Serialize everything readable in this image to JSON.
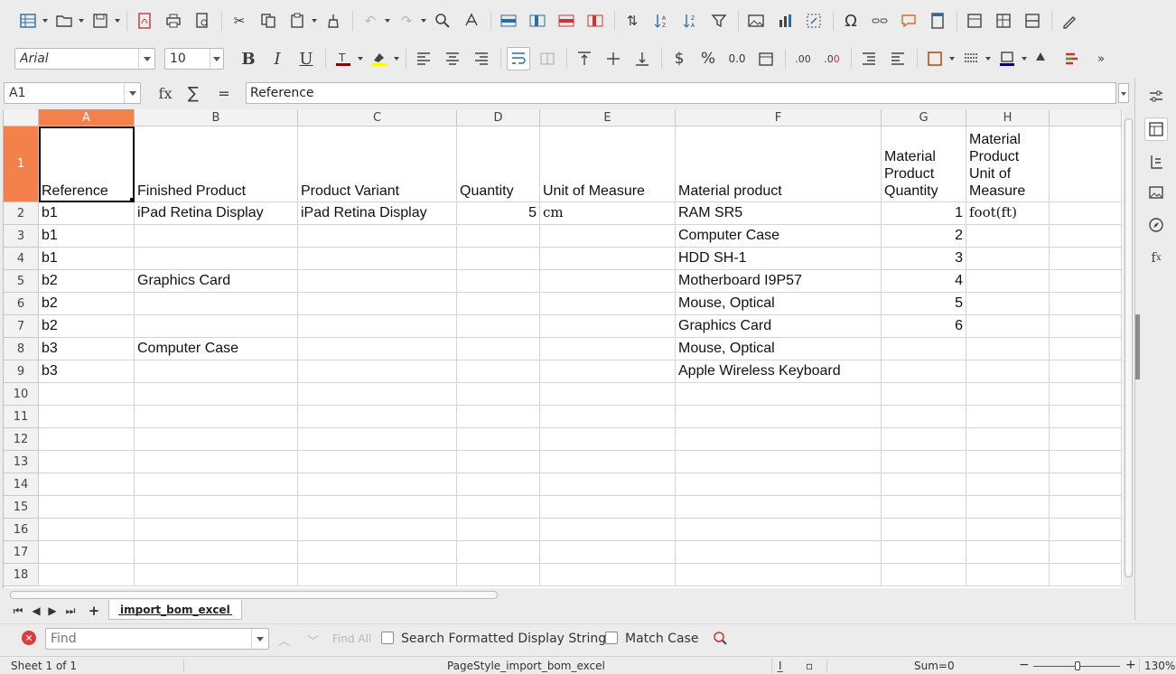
{
  "toolbar": {
    "font_name": "Arial",
    "font_size": "10"
  },
  "formula_bar": {
    "name_box": "A1",
    "fx_label": "fx",
    "sum_label": "∑",
    "eq_label": "=",
    "content": "Reference"
  },
  "columns": [
    "A",
    "B",
    "C",
    "D",
    "E",
    "F",
    "G",
    "H"
  ],
  "rows": [
    "1",
    "2",
    "3",
    "4",
    "5",
    "6",
    "7",
    "8",
    "9",
    "10",
    "11",
    "12",
    "13",
    "14",
    "15",
    "16",
    "17",
    "18"
  ],
  "header_row": {
    "A": "Reference",
    "B": "Finished Product",
    "C": "Product Variant",
    "D": "Quantity",
    "E": "Unit of Measure",
    "F": "Material product",
    "G": "Material Product Quantity",
    "H": "Material Product Unit of Measure"
  },
  "data_rows": [
    {
      "A": "b1",
      "B": "iPad Retina Display",
      "C": "iPad Retina Display",
      "D": "5",
      "E": "cm",
      "F": "RAM SR5",
      "G": "1",
      "H": "foot(ft)"
    },
    {
      "A": "b1",
      "B": "",
      "C": "",
      "D": "",
      "E": "",
      "F": "Computer Case",
      "G": "2",
      "H": ""
    },
    {
      "A": "b1",
      "B": "",
      "C": "",
      "D": "",
      "E": "",
      "F": "HDD SH-1",
      "G": "3",
      "H": ""
    },
    {
      "A": "b2",
      "B": "Graphics Card",
      "C": "",
      "D": "",
      "E": "",
      "F": "Motherboard I9P57",
      "G": "4",
      "H": ""
    },
    {
      "A": "b2",
      "B": "",
      "C": "",
      "D": "",
      "E": "",
      "F": "Mouse, Optical",
      "G": "5",
      "H": ""
    },
    {
      "A": "b2",
      "B": "",
      "C": "",
      "D": "",
      "E": "",
      "F": "Graphics Card",
      "G": "6",
      "H": ""
    },
    {
      "A": "b3",
      "B": "Computer Case",
      "C": "",
      "D": "",
      "E": "",
      "F": "Mouse, Optical",
      "G": "",
      "H": ""
    },
    {
      "A": "b3",
      "B": "",
      "C": "",
      "D": "",
      "E": "",
      "F": "Apple Wireless Keyboard",
      "G": "",
      "H": ""
    }
  ],
  "sheet_tab": "import_bom_excel",
  "find_bar": {
    "placeholder": "Find",
    "find_all": "Find All",
    "search_formatted": "Search Formatted Display String",
    "match_case": "Match Case"
  },
  "status_bar": {
    "sheet": "Sheet 1 of 1",
    "page_style": "PageStyle_import_bom_excel",
    "sum": "Sum=0",
    "zoom": "130%"
  },
  "colors": {
    "selected_header": "#f4814b",
    "grid_line": "#d4d4d4"
  }
}
